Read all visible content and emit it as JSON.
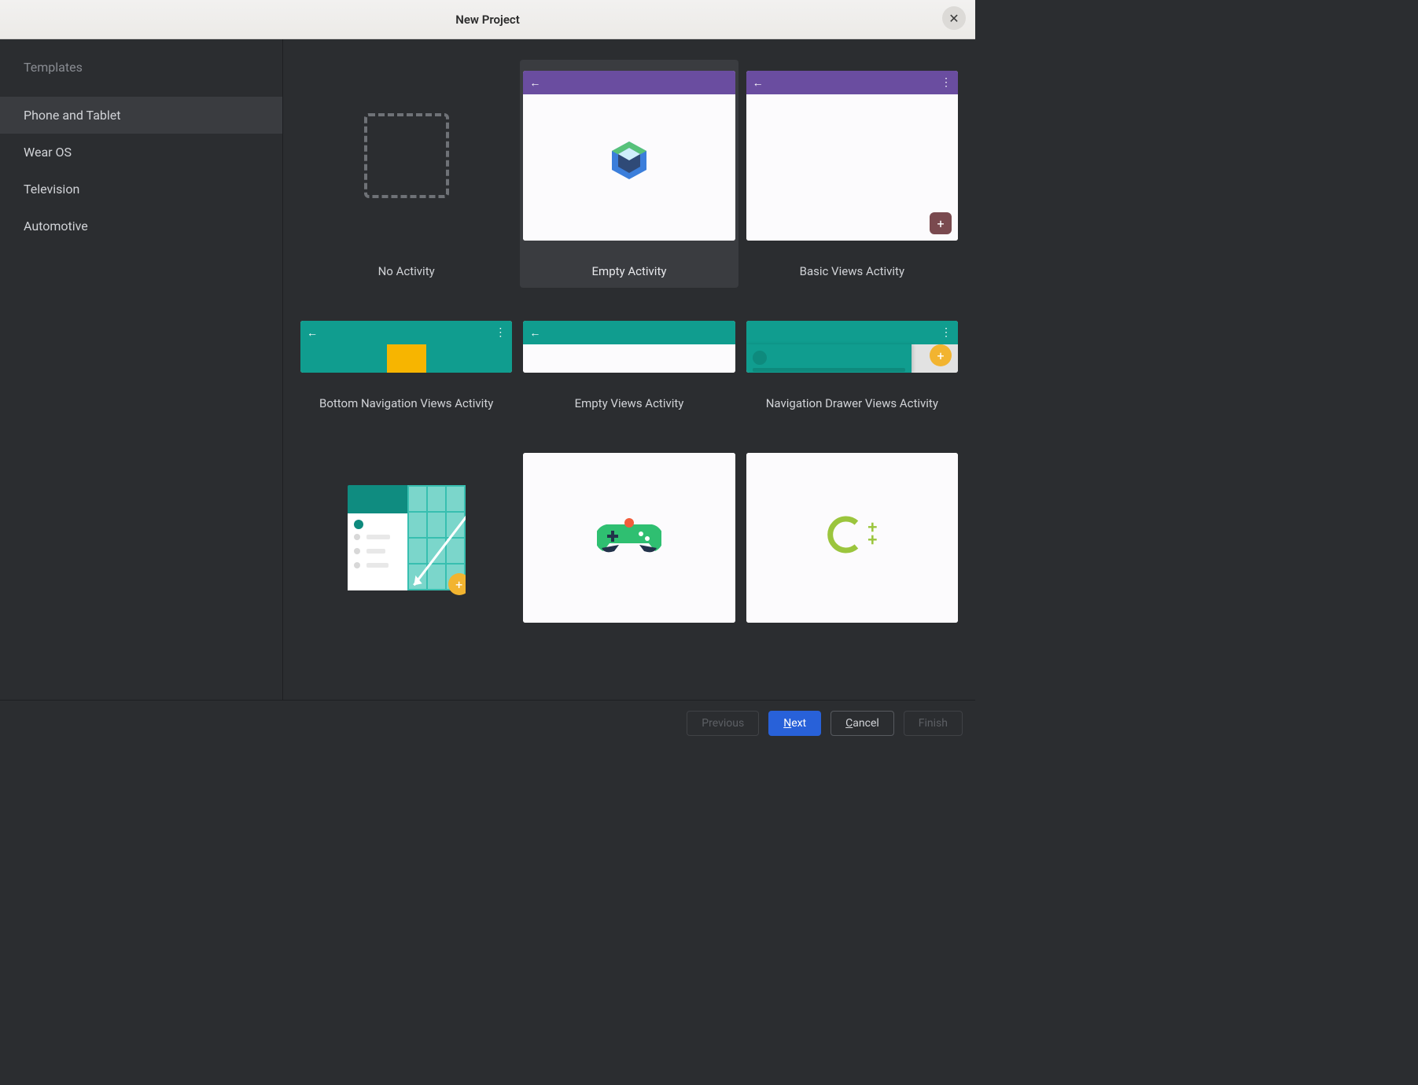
{
  "titlebar": {
    "title": "New Project"
  },
  "sidebar": {
    "header": "Templates",
    "items": [
      {
        "label": "Phone and Tablet",
        "selected": true
      },
      {
        "label": "Wear OS",
        "selected": false
      },
      {
        "label": "Television",
        "selected": false
      },
      {
        "label": "Automotive",
        "selected": false
      }
    ]
  },
  "templates": [
    {
      "id": "no-activity",
      "label": "No Activity",
      "selected": false
    },
    {
      "id": "empty-activity",
      "label": "Empty Activity",
      "selected": true
    },
    {
      "id": "basic-views-activity",
      "label": "Basic Views Activity",
      "selected": false
    },
    {
      "id": "bottom-navigation-views-activity",
      "label": "Bottom Navigation Views Activity",
      "selected": false
    },
    {
      "id": "empty-views-activity",
      "label": "Empty Views Activity",
      "selected": false
    },
    {
      "id": "navigation-drawer-views-activity",
      "label": "Navigation Drawer Views Activity",
      "selected": false
    },
    {
      "id": "responsive-views-activity",
      "label": "",
      "selected": false
    },
    {
      "id": "game-activity",
      "label": "",
      "selected": false
    },
    {
      "id": "native-cpp",
      "label": "",
      "selected": false
    }
  ],
  "footer": {
    "previous": "Previous",
    "next": "Next",
    "cancel": "Cancel",
    "finish": "Finish"
  },
  "colors": {
    "purple": "#6a4da0",
    "teal": "#109d8f",
    "orange": "#f7b500",
    "primary_button": "#2861d9"
  }
}
